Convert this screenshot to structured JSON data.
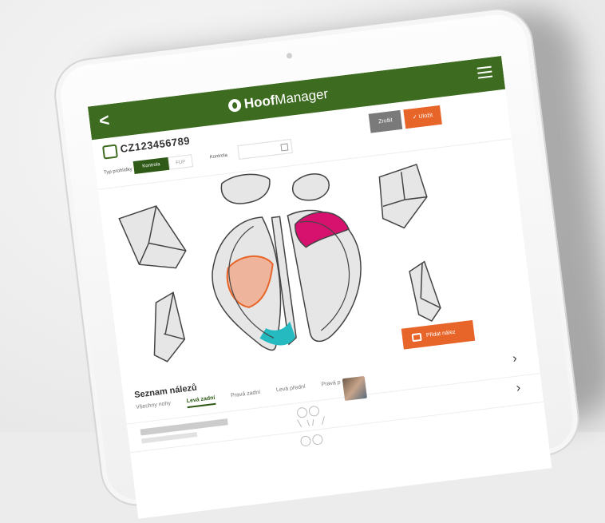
{
  "app": {
    "name_bold": "Hoof",
    "name_light": "Manager",
    "back_label": "<",
    "menu_label": "☰"
  },
  "animal": {
    "id": "CZ123456789"
  },
  "actions": {
    "cancel_label": "Zrušit",
    "save_label": "Uložit",
    "add_finding_label": "Přidat nález"
  },
  "form": {
    "type_label": "Typ prohlídky",
    "type_options": [
      "Kontrola",
      "FÚP"
    ],
    "type_selected": "Kontrola",
    "date_label": "Kontrola",
    "date_value": ""
  },
  "findings": {
    "title": "Seznam nálezů",
    "tabs": [
      "Všechny nohy",
      "Levá zadní",
      "Pravá zadní",
      "Levá přední",
      "Pravá p"
    ],
    "active_tab": "Levá zadní"
  },
  "colors": {
    "header_green": "#3d6b1f",
    "accent_orange": "#e8652a",
    "zone_magenta": "#d6126e",
    "zone_peach": "#eeb59c",
    "zone_teal": "#25b9c0",
    "zone_orange_outline": "#e8652a"
  },
  "icons": {
    "back": "chevron-left-icon",
    "menu": "hamburger-icon",
    "animal": "cow-icon",
    "save": "check-icon",
    "calendar": "calendar-icon",
    "add": "medical-kit-icon",
    "row_next": "chevron-right-icon"
  }
}
